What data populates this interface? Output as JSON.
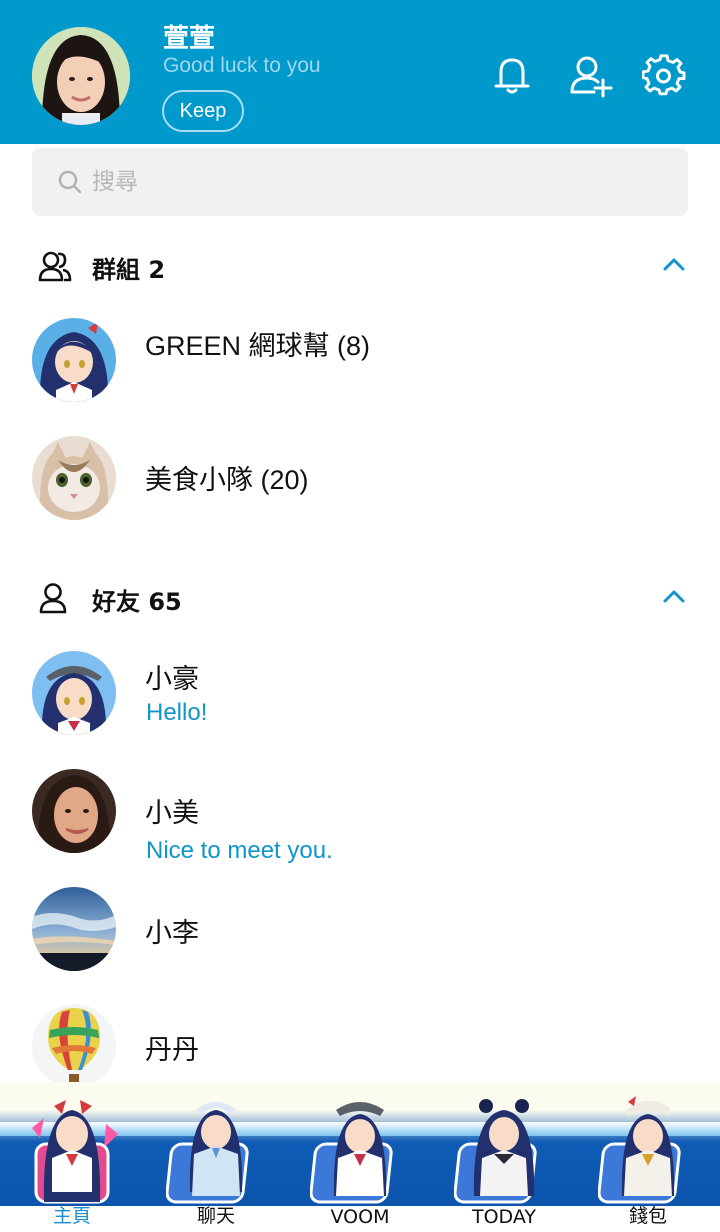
{
  "header": {
    "profile_name": "萱萱",
    "status_message": "Good luck to you",
    "keep_label": "Keep",
    "icons": [
      "bell-icon",
      "add-friend-icon",
      "gear-icon"
    ]
  },
  "search": {
    "placeholder": "搜尋"
  },
  "groups_section": {
    "title": "群組 2",
    "items": [
      {
        "name": "GREEN 網球幫 (8)",
        "avatar": "anime-girl-avatar"
      },
      {
        "name": "美食小隊 (20)",
        "avatar": "cat-avatar"
      }
    ]
  },
  "friends_section": {
    "title": "好友 65",
    "items": [
      {
        "name": "小豪",
        "message": "Hello!",
        "avatar": "anime-girl-avatar"
      },
      {
        "name": "小美",
        "message": "Nice to meet you.",
        "avatar": "woman-photo-avatar"
      },
      {
        "name": "小李",
        "message": "",
        "avatar": "sky-avatar"
      },
      {
        "name": "丹丹",
        "message": "",
        "avatar": "hot-air-balloon-avatar"
      }
    ]
  },
  "bottom_nav": {
    "items": [
      {
        "label": "主頁",
        "active": true
      },
      {
        "label": "聊天",
        "active": false
      },
      {
        "label": "VOOM",
        "active": false
      },
      {
        "label": "TODAY",
        "active": false
      },
      {
        "label": "錢包",
        "active": false
      }
    ]
  },
  "colors": {
    "header_bg": "#0099cc",
    "accent": "#0f95cc",
    "nav_bg": "#0b50a8"
  }
}
